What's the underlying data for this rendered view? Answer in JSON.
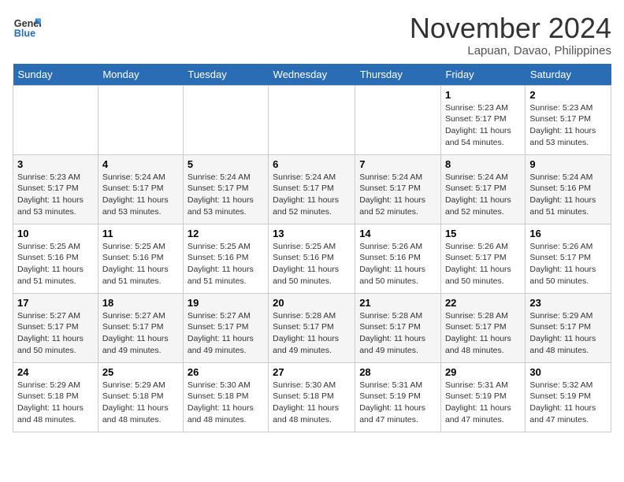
{
  "header": {
    "logo_line1": "General",
    "logo_line2": "Blue",
    "month": "November 2024",
    "location": "Lapuan, Davao, Philippines"
  },
  "weekdays": [
    "Sunday",
    "Monday",
    "Tuesday",
    "Wednesday",
    "Thursday",
    "Friday",
    "Saturday"
  ],
  "weeks": [
    [
      {
        "day": "",
        "sunrise": "",
        "sunset": "",
        "daylight": ""
      },
      {
        "day": "",
        "sunrise": "",
        "sunset": "",
        "daylight": ""
      },
      {
        "day": "",
        "sunrise": "",
        "sunset": "",
        "daylight": ""
      },
      {
        "day": "",
        "sunrise": "",
        "sunset": "",
        "daylight": ""
      },
      {
        "day": "",
        "sunrise": "",
        "sunset": "",
        "daylight": ""
      },
      {
        "day": "1",
        "sunrise": "Sunrise: 5:23 AM",
        "sunset": "Sunset: 5:17 PM",
        "daylight": "Daylight: 11 hours and 54 minutes."
      },
      {
        "day": "2",
        "sunrise": "Sunrise: 5:23 AM",
        "sunset": "Sunset: 5:17 PM",
        "daylight": "Daylight: 11 hours and 53 minutes."
      }
    ],
    [
      {
        "day": "3",
        "sunrise": "Sunrise: 5:23 AM",
        "sunset": "Sunset: 5:17 PM",
        "daylight": "Daylight: 11 hours and 53 minutes."
      },
      {
        "day": "4",
        "sunrise": "Sunrise: 5:24 AM",
        "sunset": "Sunset: 5:17 PM",
        "daylight": "Daylight: 11 hours and 53 minutes."
      },
      {
        "day": "5",
        "sunrise": "Sunrise: 5:24 AM",
        "sunset": "Sunset: 5:17 PM",
        "daylight": "Daylight: 11 hours and 53 minutes."
      },
      {
        "day": "6",
        "sunrise": "Sunrise: 5:24 AM",
        "sunset": "Sunset: 5:17 PM",
        "daylight": "Daylight: 11 hours and 52 minutes."
      },
      {
        "day": "7",
        "sunrise": "Sunrise: 5:24 AM",
        "sunset": "Sunset: 5:17 PM",
        "daylight": "Daylight: 11 hours and 52 minutes."
      },
      {
        "day": "8",
        "sunrise": "Sunrise: 5:24 AM",
        "sunset": "Sunset: 5:17 PM",
        "daylight": "Daylight: 11 hours and 52 minutes."
      },
      {
        "day": "9",
        "sunrise": "Sunrise: 5:24 AM",
        "sunset": "Sunset: 5:16 PM",
        "daylight": "Daylight: 11 hours and 51 minutes."
      }
    ],
    [
      {
        "day": "10",
        "sunrise": "Sunrise: 5:25 AM",
        "sunset": "Sunset: 5:16 PM",
        "daylight": "Daylight: 11 hours and 51 minutes."
      },
      {
        "day": "11",
        "sunrise": "Sunrise: 5:25 AM",
        "sunset": "Sunset: 5:16 PM",
        "daylight": "Daylight: 11 hours and 51 minutes."
      },
      {
        "day": "12",
        "sunrise": "Sunrise: 5:25 AM",
        "sunset": "Sunset: 5:16 PM",
        "daylight": "Daylight: 11 hours and 51 minutes."
      },
      {
        "day": "13",
        "sunrise": "Sunrise: 5:25 AM",
        "sunset": "Sunset: 5:16 PM",
        "daylight": "Daylight: 11 hours and 50 minutes."
      },
      {
        "day": "14",
        "sunrise": "Sunrise: 5:26 AM",
        "sunset": "Sunset: 5:16 PM",
        "daylight": "Daylight: 11 hours and 50 minutes."
      },
      {
        "day": "15",
        "sunrise": "Sunrise: 5:26 AM",
        "sunset": "Sunset: 5:17 PM",
        "daylight": "Daylight: 11 hours and 50 minutes."
      },
      {
        "day": "16",
        "sunrise": "Sunrise: 5:26 AM",
        "sunset": "Sunset: 5:17 PM",
        "daylight": "Daylight: 11 hours and 50 minutes."
      }
    ],
    [
      {
        "day": "17",
        "sunrise": "Sunrise: 5:27 AM",
        "sunset": "Sunset: 5:17 PM",
        "daylight": "Daylight: 11 hours and 50 minutes."
      },
      {
        "day": "18",
        "sunrise": "Sunrise: 5:27 AM",
        "sunset": "Sunset: 5:17 PM",
        "daylight": "Daylight: 11 hours and 49 minutes."
      },
      {
        "day": "19",
        "sunrise": "Sunrise: 5:27 AM",
        "sunset": "Sunset: 5:17 PM",
        "daylight": "Daylight: 11 hours and 49 minutes."
      },
      {
        "day": "20",
        "sunrise": "Sunrise: 5:28 AM",
        "sunset": "Sunset: 5:17 PM",
        "daylight": "Daylight: 11 hours and 49 minutes."
      },
      {
        "day": "21",
        "sunrise": "Sunrise: 5:28 AM",
        "sunset": "Sunset: 5:17 PM",
        "daylight": "Daylight: 11 hours and 49 minutes."
      },
      {
        "day": "22",
        "sunrise": "Sunrise: 5:28 AM",
        "sunset": "Sunset: 5:17 PM",
        "daylight": "Daylight: 11 hours and 48 minutes."
      },
      {
        "day": "23",
        "sunrise": "Sunrise: 5:29 AM",
        "sunset": "Sunset: 5:17 PM",
        "daylight": "Daylight: 11 hours and 48 minutes."
      }
    ],
    [
      {
        "day": "24",
        "sunrise": "Sunrise: 5:29 AM",
        "sunset": "Sunset: 5:18 PM",
        "daylight": "Daylight: 11 hours and 48 minutes."
      },
      {
        "day": "25",
        "sunrise": "Sunrise: 5:29 AM",
        "sunset": "Sunset: 5:18 PM",
        "daylight": "Daylight: 11 hours and 48 minutes."
      },
      {
        "day": "26",
        "sunrise": "Sunrise: 5:30 AM",
        "sunset": "Sunset: 5:18 PM",
        "daylight": "Daylight: 11 hours and 48 minutes."
      },
      {
        "day": "27",
        "sunrise": "Sunrise: 5:30 AM",
        "sunset": "Sunset: 5:18 PM",
        "daylight": "Daylight: 11 hours and 48 minutes."
      },
      {
        "day": "28",
        "sunrise": "Sunrise: 5:31 AM",
        "sunset": "Sunset: 5:19 PM",
        "daylight": "Daylight: 11 hours and 47 minutes."
      },
      {
        "day": "29",
        "sunrise": "Sunrise: 5:31 AM",
        "sunset": "Sunset: 5:19 PM",
        "daylight": "Daylight: 11 hours and 47 minutes."
      },
      {
        "day": "30",
        "sunrise": "Sunrise: 5:32 AM",
        "sunset": "Sunset: 5:19 PM",
        "daylight": "Daylight: 11 hours and 47 minutes."
      }
    ]
  ]
}
